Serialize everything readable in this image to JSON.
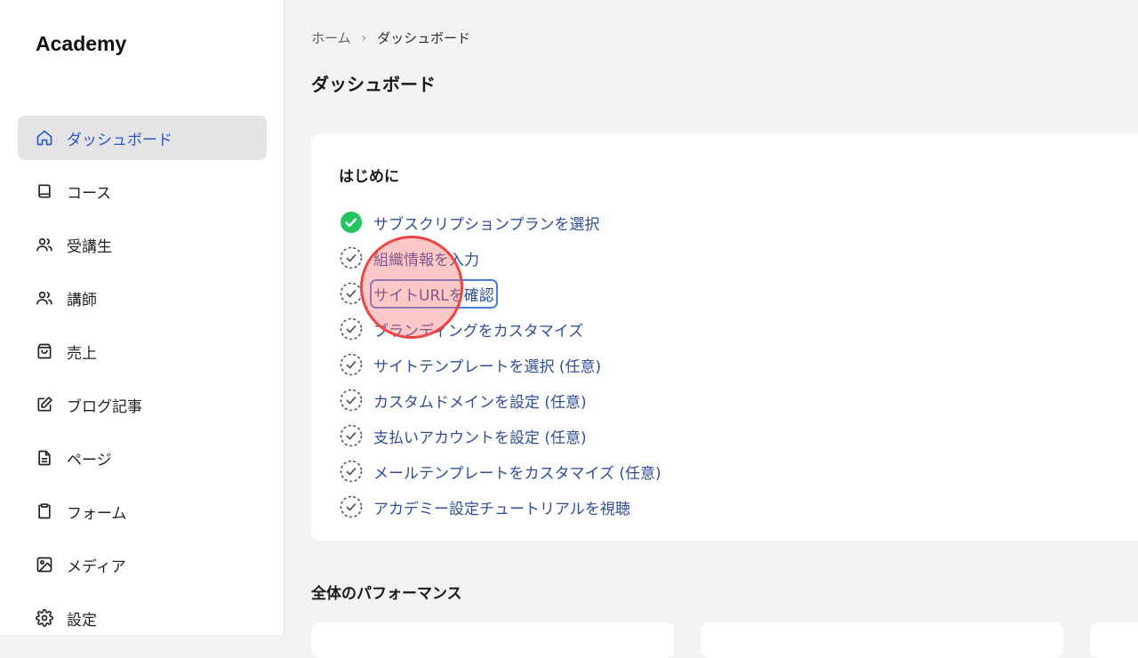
{
  "app": {
    "brand": "Academy"
  },
  "sidebar": {
    "items": [
      {
        "label": "ダッシュボード",
        "icon": "home-icon",
        "active": true
      },
      {
        "label": "コース",
        "icon": "book-icon"
      },
      {
        "label": "受講生",
        "icon": "users-icon"
      },
      {
        "label": "講師",
        "icon": "users-icon"
      },
      {
        "label": "売上",
        "icon": "shopping-bag-icon"
      },
      {
        "label": "ブログ記事",
        "icon": "edit-icon"
      },
      {
        "label": "ページ",
        "icon": "document-icon"
      },
      {
        "label": "フォーム",
        "icon": "clipboard-icon"
      },
      {
        "label": "メディア",
        "icon": "image-icon"
      },
      {
        "label": "設定",
        "icon": "gear-icon"
      }
    ]
  },
  "breadcrumb": {
    "home": "ホーム",
    "current": "ダッシュボード"
  },
  "page": {
    "title": "ダッシュボード"
  },
  "getting_started": {
    "title": "はじめに",
    "items": [
      {
        "label": "サブスクリプションプランを選択",
        "done": true
      },
      {
        "label": "組織情報を入力",
        "done": false
      },
      {
        "label": "サイトURLを確認",
        "done": false
      },
      {
        "label": "ブランディングをカスタマイズ",
        "done": false
      },
      {
        "label": "サイトテンプレートを選択 (任意)",
        "done": false
      },
      {
        "label": "カスタムドメインを設定 (任意)",
        "done": false
      },
      {
        "label": "支払いアカウントを設定 (任意)",
        "done": false
      },
      {
        "label": "メールテンプレートをカスタマイズ (任意)",
        "done": false
      },
      {
        "label": "アカデミー設定チュートリアルを視聴",
        "done": false
      }
    ]
  },
  "performance": {
    "title": "全体のパフォーマンス"
  },
  "colors": {
    "accent": "#2b57c8",
    "link": "#2f4d9a",
    "success": "#22c55e",
    "marker": "#ef4444"
  }
}
